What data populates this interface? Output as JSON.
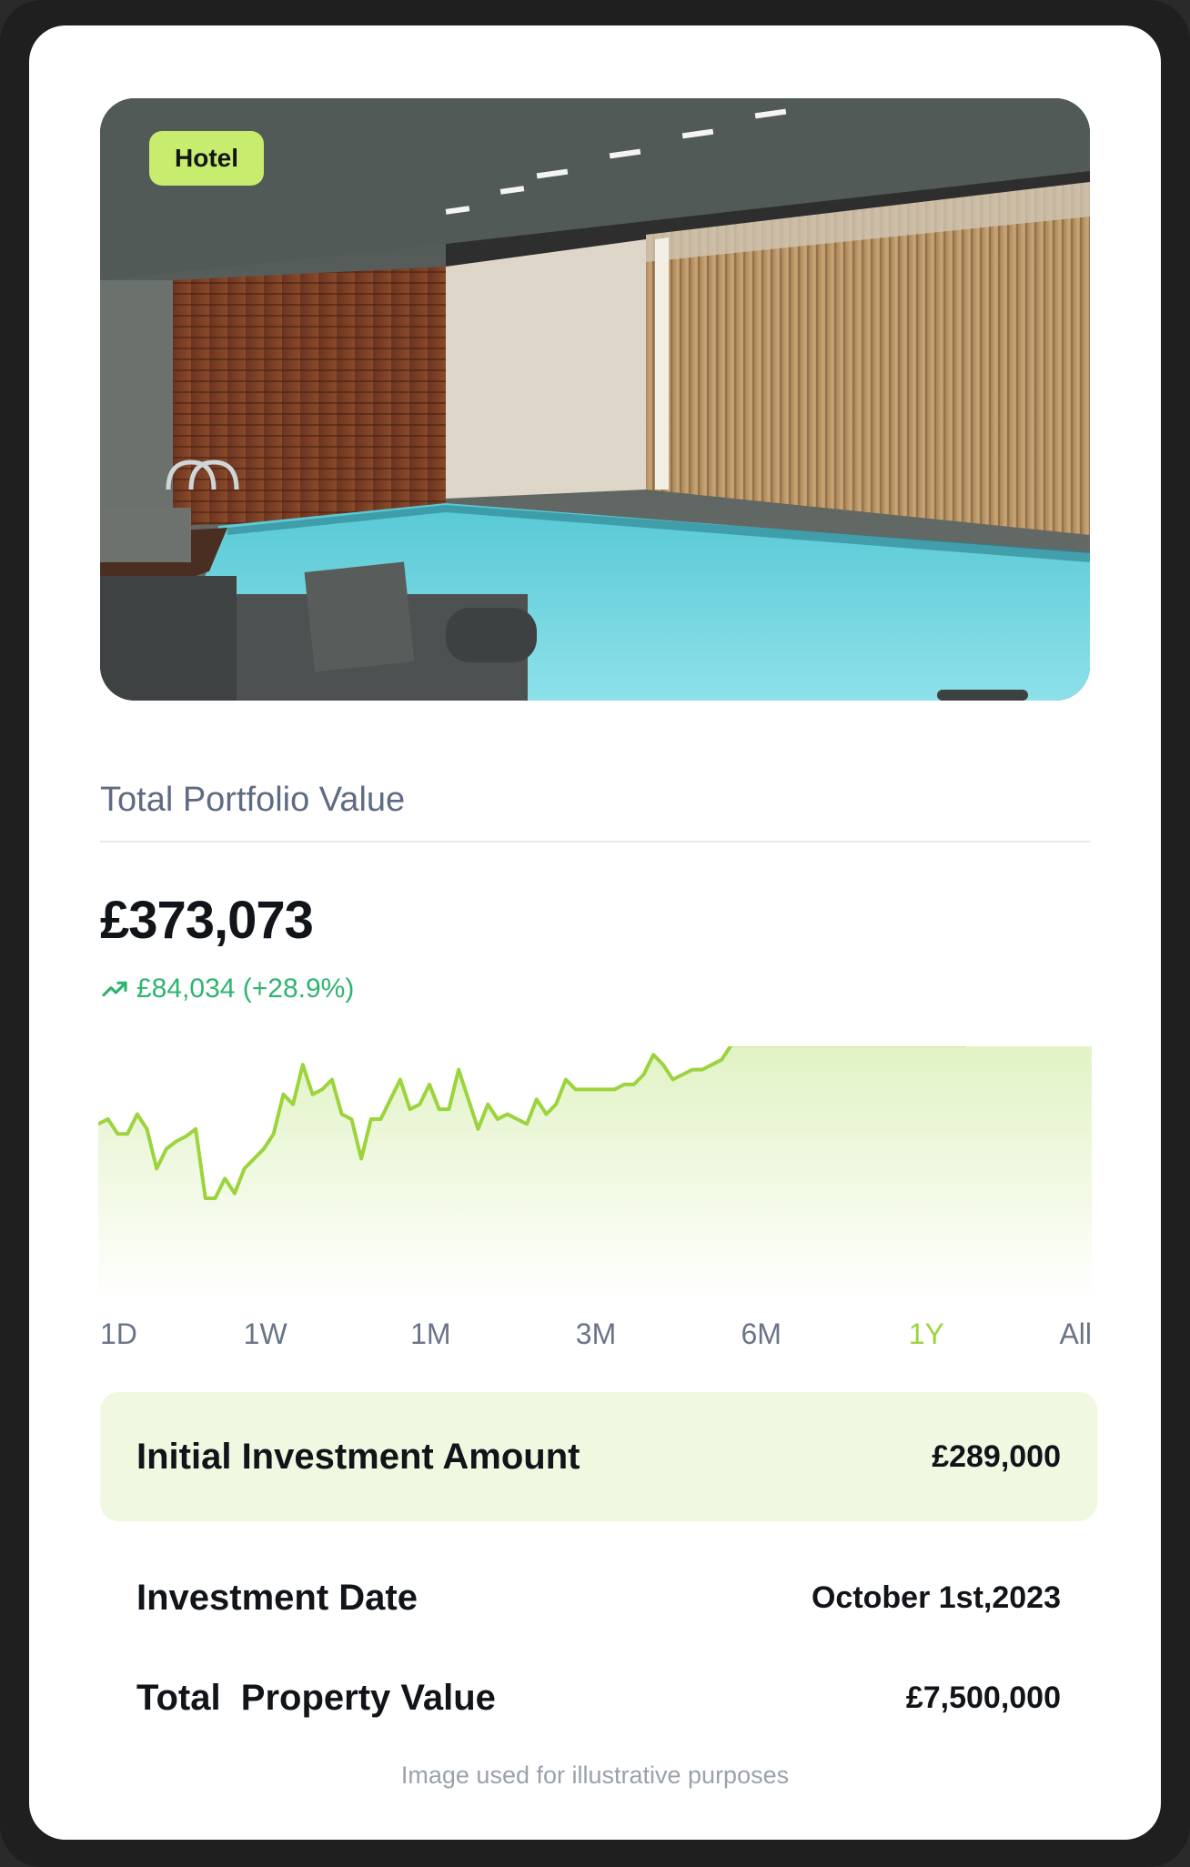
{
  "property": {
    "category_tag": "Hotel"
  },
  "portfolio": {
    "title": "Total Portfolio Value",
    "value": "£373,073",
    "change_text": "£84,034 (+28.9%)"
  },
  "ranges": {
    "items": [
      "1D",
      "1W",
      "1M",
      "3M",
      "6M",
      "1Y",
      "All"
    ],
    "selected": "1Y"
  },
  "details": {
    "initial_label": "Initial Investment Amount",
    "initial_value": "£289,000",
    "date_label": "Investment Date",
    "date_value": "October 1st,2023",
    "property_label": "Total  Property Value",
    "property_value": "£7,500,000"
  },
  "footer": {
    "disclaimer": "Image used for illustrative purposes"
  },
  "colors": {
    "accent_green": "#9bd43c",
    "positive": "#2fb46f",
    "tag_bg": "#c8ec6e"
  },
  "icons": {
    "trend": "trend-up-icon"
  },
  "chart_data": {
    "type": "area",
    "values": [
      48,
      50,
      44,
      44,
      52,
      46,
      30,
      38,
      41,
      43,
      46,
      18,
      18,
      26,
      20,
      30,
      34,
      38,
      44,
      60,
      56,
      72,
      60,
      62,
      66,
      52,
      50,
      34,
      50,
      50,
      58,
      66,
      54,
      56,
      64,
      54,
      54,
      70,
      58,
      46,
      56,
      50,
      52,
      50,
      48,
      58,
      52,
      56,
      66,
      62,
      62,
      62,
      62,
      62,
      64,
      64,
      68,
      76,
      72,
      66,
      68,
      70,
      70,
      72,
      74,
      80,
      80,
      80,
      80,
      80,
      80,
      80,
      80,
      80,
      80,
      80,
      80,
      80,
      80,
      80,
      80,
      80,
      80,
      80,
      80,
      80,
      80,
      80,
      80,
      80,
      88,
      88,
      88,
      88,
      88,
      88,
      88,
      88,
      88,
      88,
      86,
      88,
      88
    ],
    "ylim": [
      0,
      100
    ],
    "series_color": "#9bd43c"
  }
}
